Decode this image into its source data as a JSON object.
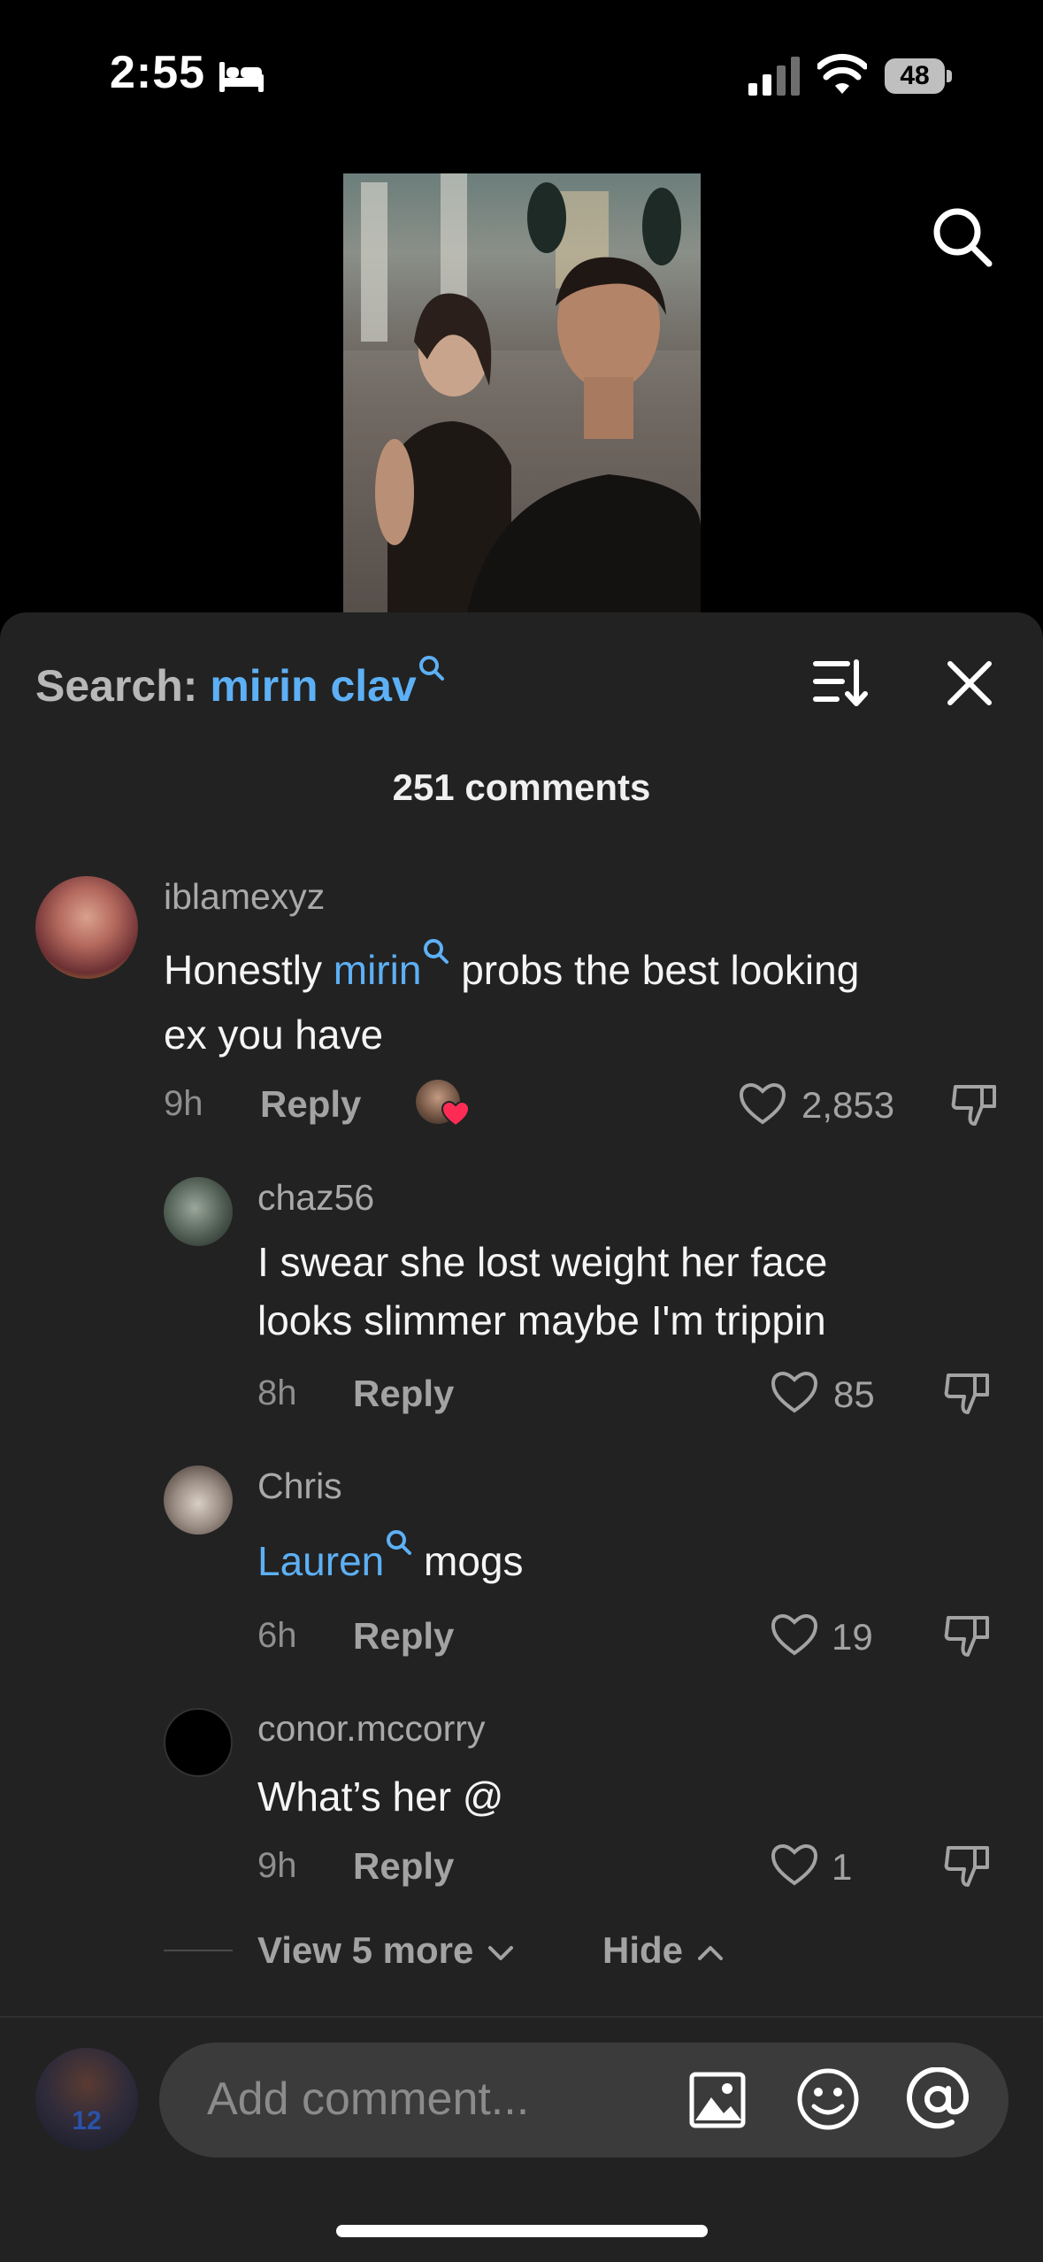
{
  "status_bar": {
    "time": "2:55",
    "battery": "48"
  },
  "sheet": {
    "search_prefix": "Search:",
    "search_term": "mirin clav",
    "comment_count": "251 comments"
  },
  "comments": [
    {
      "username": "iblamexyz",
      "text_highlight": "mirin",
      "text_prefix": "Honestly",
      "text_line1_rest": "probs the best looking",
      "text_line2": "ex you have",
      "time": "9h",
      "reply_label": "Reply",
      "likes": "2,853"
    },
    {
      "username": "chaz56",
      "text_line1": "I swear she lost weight her face",
      "text_line2": "looks slimmer maybe I'm trippin",
      "time": "8h",
      "reply_label": "Reply",
      "likes": "85"
    },
    {
      "username": "Chris",
      "text_highlight": "Lauren",
      "text_rest": "mogs",
      "time": "6h",
      "reply_label": "Reply",
      "likes": "19"
    },
    {
      "username": "conor.mccorry",
      "text": "What’s her @",
      "time": "9h",
      "reply_label": "Reply",
      "likes": "1"
    }
  ],
  "thread_controls": {
    "view_more": "View 5 more",
    "hide": "Hide"
  },
  "composer": {
    "placeholder": "Add comment...",
    "avatar_number": "12"
  },
  "colors": {
    "accent": "#5db0f5",
    "sheet": "#222222",
    "like_badge": "#fe2c55"
  }
}
